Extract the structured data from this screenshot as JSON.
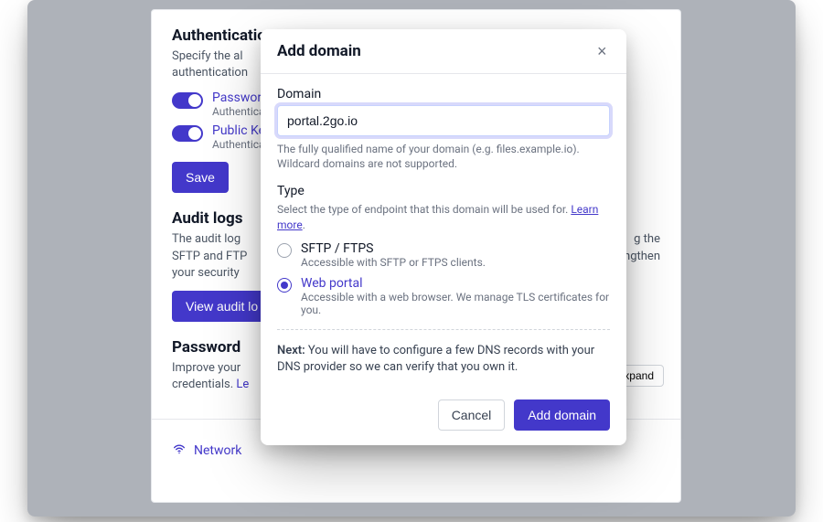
{
  "bg": {
    "auth": {
      "title": "Authentication",
      "desc_visible": "Specify the al",
      "desc_line2_visible": "authentication",
      "items": [
        {
          "label": "Password",
          "sub": "Authentica"
        },
        {
          "label": "Public Ke",
          "sub": "Authentica"
        }
      ],
      "save_label": "Save"
    },
    "audit": {
      "title": "Audit logs",
      "desc1": "The audit log",
      "desc2": "SFTP and FTP",
      "desc3": "your security",
      "desc_tail1": "g the",
      "desc_tail2": "engthen",
      "button": "View audit lo"
    },
    "password": {
      "title": "Password",
      "desc1": "Improve your",
      "desc2_prefix": "credentials. ",
      "desc2_link": "Le",
      "expand": "Expand"
    },
    "network": {
      "label": "Network"
    }
  },
  "modal": {
    "title": "Add domain",
    "domain": {
      "label": "Domain",
      "value": "portal.2go.io",
      "help": "The fully qualified name of your domain (e.g. files.example.io). Wildcard domains are not supported."
    },
    "type": {
      "label": "Type",
      "desc_prefix": "Select the type of endpoint that this domain will be used for. ",
      "learn_more": "Learn more",
      "desc_suffix": ".",
      "options": [
        {
          "id": "sftp",
          "label": "SFTP / FTPS",
          "sub": "Accessible with SFTP or FTPS clients.",
          "selected": false
        },
        {
          "id": "web",
          "label": "Web portal",
          "sub": "Accessible with a web browser. We manage TLS certificates for you.",
          "selected": true
        }
      ]
    },
    "next_prefix": "Next:",
    "next_text": " You will have to configure a few DNS records with your DNS provider so we can verify that you own it.",
    "cancel": "Cancel",
    "submit": "Add domain"
  }
}
